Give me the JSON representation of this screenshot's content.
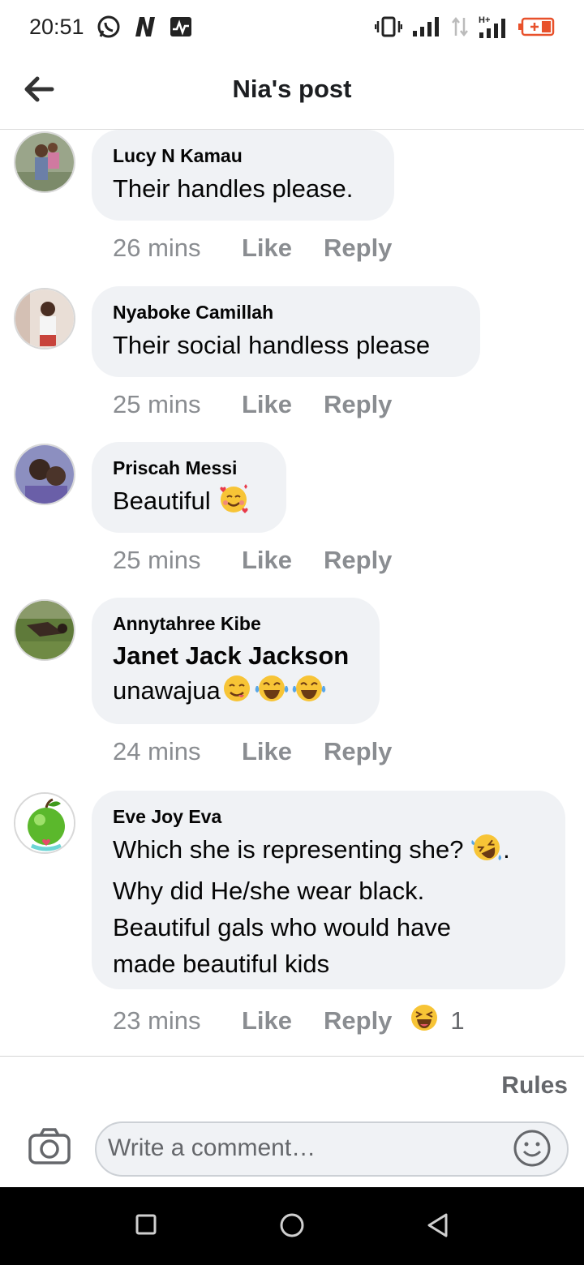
{
  "status": {
    "time": "20:51",
    "icons": [
      "whatsapp-icon",
      "n-app-icon",
      "activity-icon",
      "vibrate-icon",
      "signal-icon",
      "data-arrows-icon",
      "h-plus-signal-icon",
      "battery-charging-icon"
    ],
    "network": "H+"
  },
  "header": {
    "title": "Nia's post",
    "back_icon": "arrow-left-icon"
  },
  "comments": [
    {
      "author": "Lucy N Kamau",
      "text": "Their handles please.",
      "time": "26 mins",
      "like": "Like",
      "reply": "Reply"
    },
    {
      "author": "Nyaboke Camillah",
      "text": "Their social handless please",
      "time": "25 mins",
      "like": "Like",
      "reply": "Reply"
    },
    {
      "author": "Priscah Messi",
      "text": "Beautiful",
      "emoji": [
        "smiling-face-with-hearts-icon"
      ],
      "time": "25 mins",
      "like": "Like",
      "reply": "Reply"
    },
    {
      "author": "Annytahree Kibe",
      "mention": "Janet Jack Jackson",
      "text": "unawajua",
      "emoji": [
        "yum-face-icon",
        "tears-of-joy-icon",
        "tears-of-joy-icon"
      ],
      "time": "24 mins",
      "like": "Like",
      "reply": "Reply"
    },
    {
      "author": "Eve Joy Eva",
      "line1": "Which she is representing she?",
      "line1_end": ".",
      "line2": "Why did He/she wear black.",
      "line3": "Beautiful gals who would have",
      "line4": "made beautiful kids",
      "emoji": [
        "rolling-laughing-icon"
      ],
      "time": "23 mins",
      "like": "Like",
      "reply": "Reply",
      "reaction_icon": "squinting-laugh-icon",
      "reaction_count": "1"
    }
  ],
  "composer": {
    "rules": "Rules",
    "placeholder": "Write a comment…",
    "camera_icon": "camera-icon",
    "emoji_icon": "smiley-icon"
  },
  "nav": [
    "recents-square-icon",
    "home-circle-icon",
    "back-triangle-icon"
  ],
  "colors": {
    "bubble": "#f0f2f5",
    "meta": "#8a8d91",
    "battery_accent": "#e8512b"
  }
}
